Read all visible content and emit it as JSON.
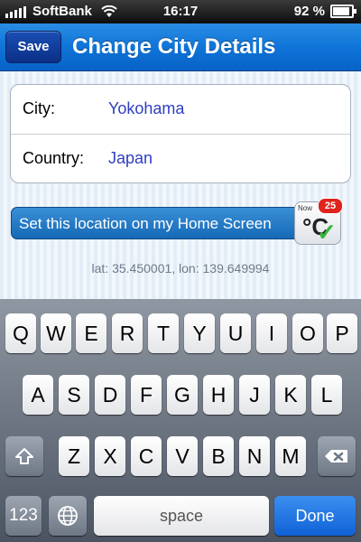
{
  "status_bar": {
    "carrier": "SoftBank",
    "time": "16:17",
    "battery": "92 %"
  },
  "nav": {
    "save_label": "Save",
    "title": "Change City Details"
  },
  "form": {
    "city_label": "City:",
    "city_value": "Yokohama",
    "country_label": "Country:",
    "country_value": "Japan"
  },
  "home_button": {
    "label": "Set this location on my Home Screen",
    "icon_text": "Now",
    "icon_glyph": "°C",
    "badge": "25"
  },
  "coordinates": "lat: 35.450001, lon: 139.649994",
  "keyboard": {
    "row1": [
      "Q",
      "W",
      "E",
      "R",
      "T",
      "Y",
      "U",
      "I",
      "O",
      "P"
    ],
    "row2": [
      "A",
      "S",
      "D",
      "F",
      "G",
      "H",
      "J",
      "K",
      "L"
    ],
    "row3": [
      "Z",
      "X",
      "C",
      "V",
      "B",
      "N",
      "M"
    ],
    "numbers_label": "123",
    "space_label": "space",
    "done_label": "Done"
  }
}
